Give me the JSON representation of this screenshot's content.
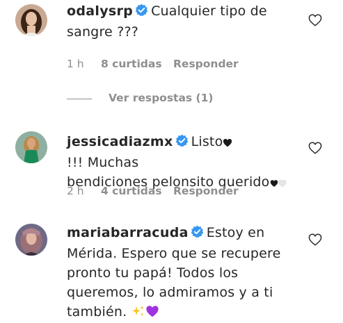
{
  "comments": [
    {
      "username": "odalysrp",
      "text_lines": [
        "Cualquier tipo de",
        "sangre ???"
      ],
      "time": "1 h",
      "likes": "8 curtidas",
      "reply_label": "Responder",
      "view_replies": "Ver respostas (1)",
      "avatar_colors": {
        "bg": "#c9a992",
        "hair": "#3b2417",
        "face": "#e7c2a6"
      }
    },
    {
      "username": "jessicadiazmx",
      "text_before_heart": "Listo",
      "text_after_heart": " !!! Muchas",
      "text_line2": "bendiciones pelonsito querido",
      "time": "2 h",
      "likes": "4 curtidas",
      "reply_label": "Responder",
      "avatar_colors": {
        "bg": "#8fb0a0",
        "hair": "#b88a4a",
        "face": "#d9a37e",
        "dress": "#1b8a5a"
      }
    },
    {
      "username": "mariabarracuda",
      "text_lines": [
        "Estoy en",
        "Mérida. Espero que se recupere",
        "pronto tu papá! Todos los",
        "queremos, lo admiramos y a ti",
        "también."
      ],
      "avatar_colors": {
        "bg": "#6e6a86",
        "hair": "#9a6f76",
        "face": "#e2b7a4"
      }
    }
  ],
  "colors": {
    "text": "#262626",
    "muted": "#8e8e8e",
    "verified": "#3897f0",
    "purple_heart": "#a033e0",
    "sparkles": "#f5c518"
  },
  "icons": [
    "verified-badge-icon",
    "heart-outline-icon",
    "black-heart-emoji",
    "white-heart-emoji",
    "sparkles-emoji",
    "purple-heart-emoji"
  ]
}
